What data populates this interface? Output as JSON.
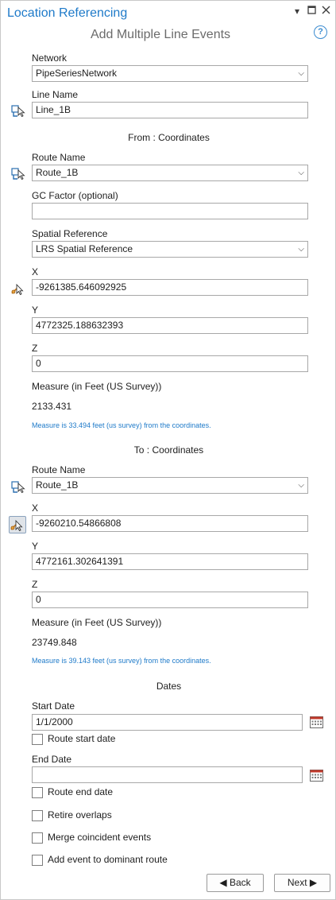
{
  "header": {
    "title": "Location Referencing",
    "subtitle": "Add Multiple Line Events"
  },
  "colors": {
    "accent": "#1e7ac9"
  },
  "network": {
    "label": "Network",
    "value": "PipeSeriesNetwork"
  },
  "line_name": {
    "label": "Line Name",
    "value": "Line_1B"
  },
  "from": {
    "heading": "From : Coordinates",
    "route_label": "Route Name",
    "route_value": "Route_1B",
    "gc_label": "GC Factor (optional)",
    "gc_value": "",
    "spatial_label": "Spatial Reference",
    "spatial_value": "LRS Spatial Reference",
    "x_label": "X",
    "x_value": "-9261385.646092925",
    "y_label": "Y",
    "y_value": "4772325.188632393",
    "z_label": "Z",
    "z_value": "0",
    "measure_label": "Measure (in Feet (US Survey))",
    "measure_value": "2133.431",
    "measure_note": "Measure is 33.494 feet (us survey) from the coordinates."
  },
  "to": {
    "heading": "To : Coordinates",
    "route_label": "Route Name",
    "route_value": "Route_1B",
    "x_label": "X",
    "x_value": "-9260210.54866808",
    "y_label": "Y",
    "y_value": "4772161.302641391",
    "z_label": "Z",
    "z_value": "0",
    "measure_label": "Measure (in Feet (US Survey))",
    "measure_value": "23749.848",
    "measure_note": "Measure is 39.143 feet (us survey) from the coordinates."
  },
  "dates": {
    "heading": "Dates",
    "start_label": "Start Date",
    "start_value": "1/1/2000",
    "route_start_label": "Route start date",
    "end_label": "End Date",
    "end_value": "",
    "route_end_label": "Route end date"
  },
  "options": {
    "retire_label": "Retire overlaps",
    "merge_label": "Merge coincident events",
    "dominant_label": "Add event to dominant route"
  },
  "footer": {
    "back_label": "◀ Back",
    "next_label": "Next ▶"
  },
  "icons": {
    "pick_route": "route-pick-icon",
    "pick_point": "point-pick-icon",
    "calendar": "calendar-icon",
    "help": "help-icon"
  }
}
